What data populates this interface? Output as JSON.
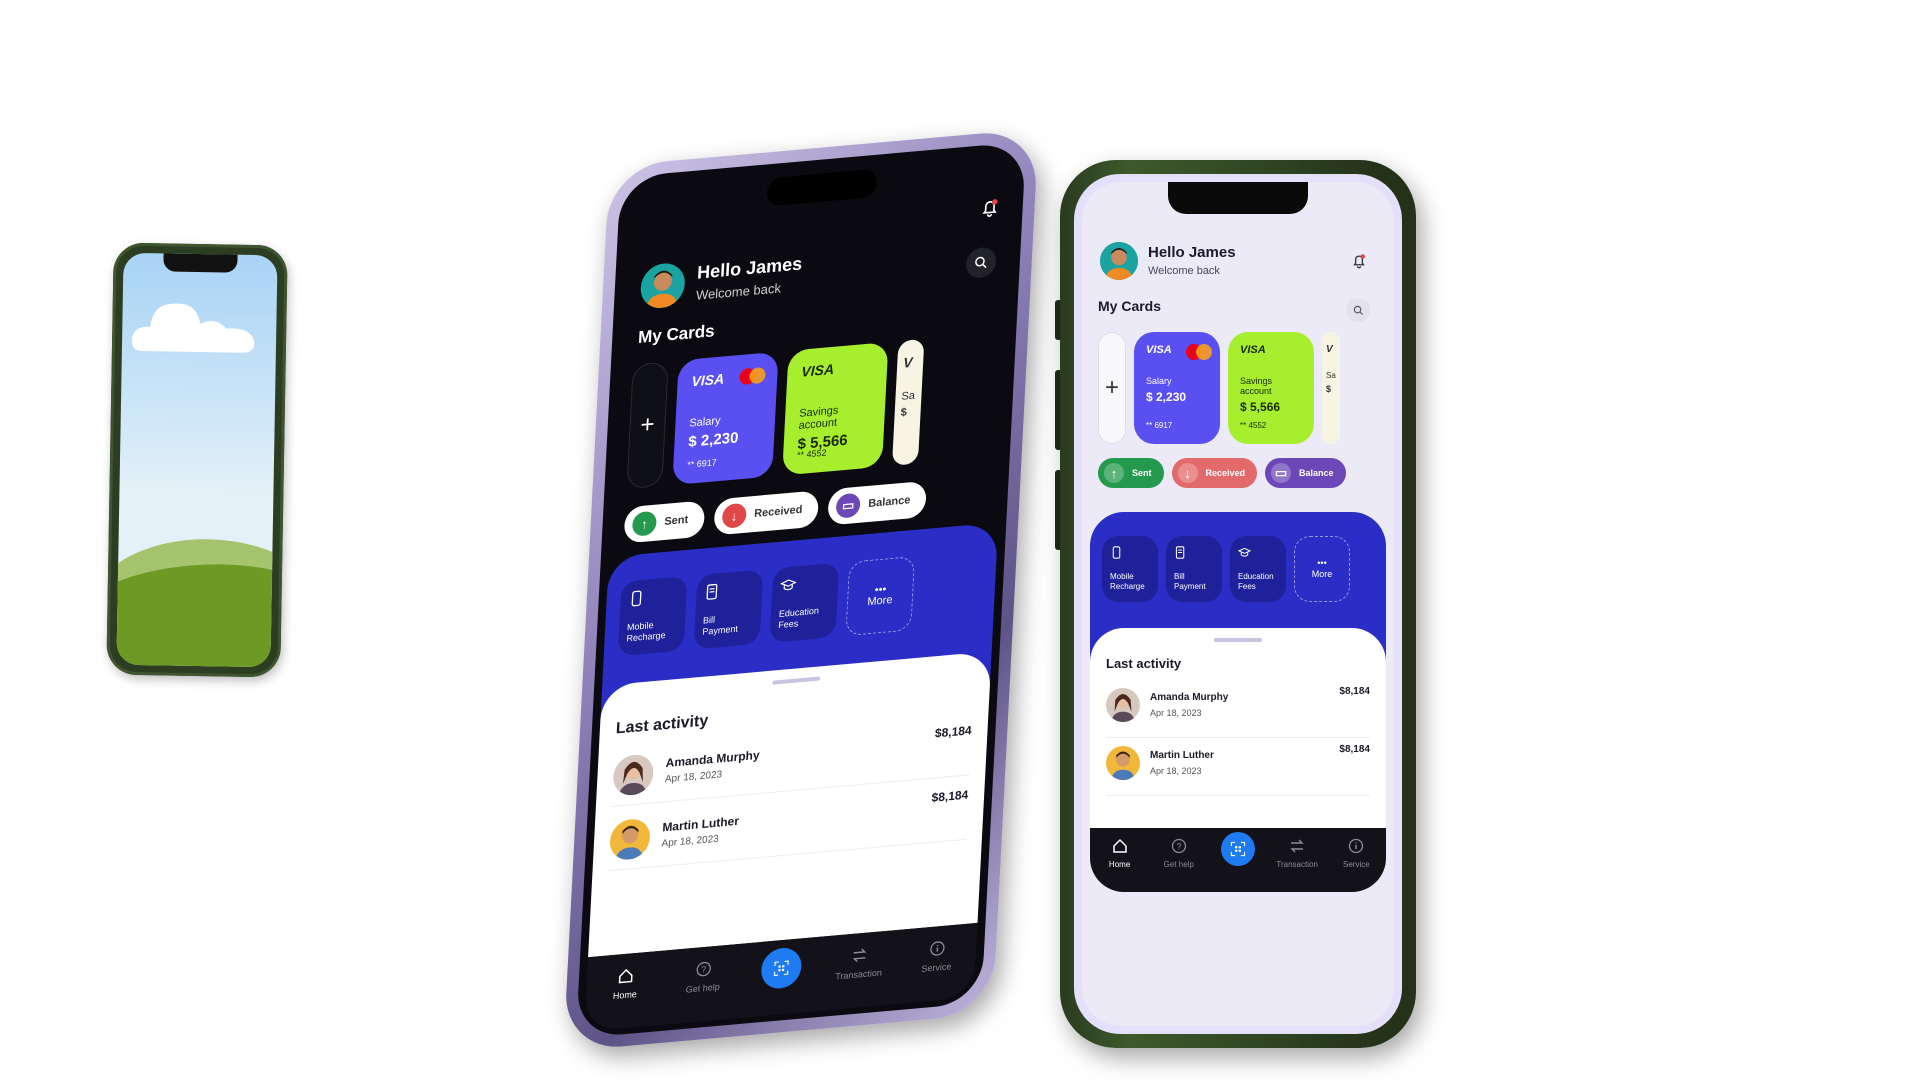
{
  "app": {
    "greeting": "Hello James",
    "subtitle": "Welcome back",
    "cards_title": "My Cards",
    "add_card": "+",
    "cards": [
      {
        "brand": "VISA",
        "label": "Salary",
        "amount": "$ 2,230",
        "number": "** 6917",
        "color": "#5a4ff0"
      },
      {
        "brand": "VISA",
        "label": "Savings account",
        "amount": "$ 5,566",
        "number": "** 4552",
        "color": "#a6ee2e"
      },
      {
        "brand": "V",
        "label": "Sa",
        "amount": "$",
        "number": "**",
        "color": "#f7f4e4"
      }
    ],
    "actions": [
      {
        "label": "Sent",
        "color": "#239a4d"
      },
      {
        "label": "Received",
        "color": "#e04848"
      },
      {
        "label": "Balance",
        "color": "#6c47b8"
      }
    ],
    "services": [
      {
        "label": "Mobile Recharge",
        "icon": "phone-icon"
      },
      {
        "label": "Bill Payment",
        "icon": "bill-icon"
      },
      {
        "label": "Education Fees",
        "icon": "graduation-cap-icon"
      },
      {
        "label": "More",
        "icon": "dots-icon"
      }
    ],
    "activity_title": "Last activity",
    "activity": [
      {
        "name": "Amanda Murphy",
        "date": "Apr 18, 2023",
        "amount": "$8,184"
      },
      {
        "name": "Martin Luther",
        "date": "Apr 18, 2023",
        "amount": "$8,184"
      }
    ],
    "nav": [
      {
        "label": "Home",
        "icon": "home-icon",
        "active": true
      },
      {
        "label": "Get help",
        "icon": "help-icon"
      },
      {
        "label": "",
        "icon": "qr-scan-icon"
      },
      {
        "label": "Transaction",
        "icon": "transfer-icon"
      },
      {
        "label": "Service",
        "icon": "info-icon"
      }
    ]
  },
  "colors": {
    "services_panel": "#2a2dc6",
    "scan_button": "#1e7bf2",
    "dark_frame": "#8e80b8",
    "green_frame": "#2a3a1f"
  }
}
